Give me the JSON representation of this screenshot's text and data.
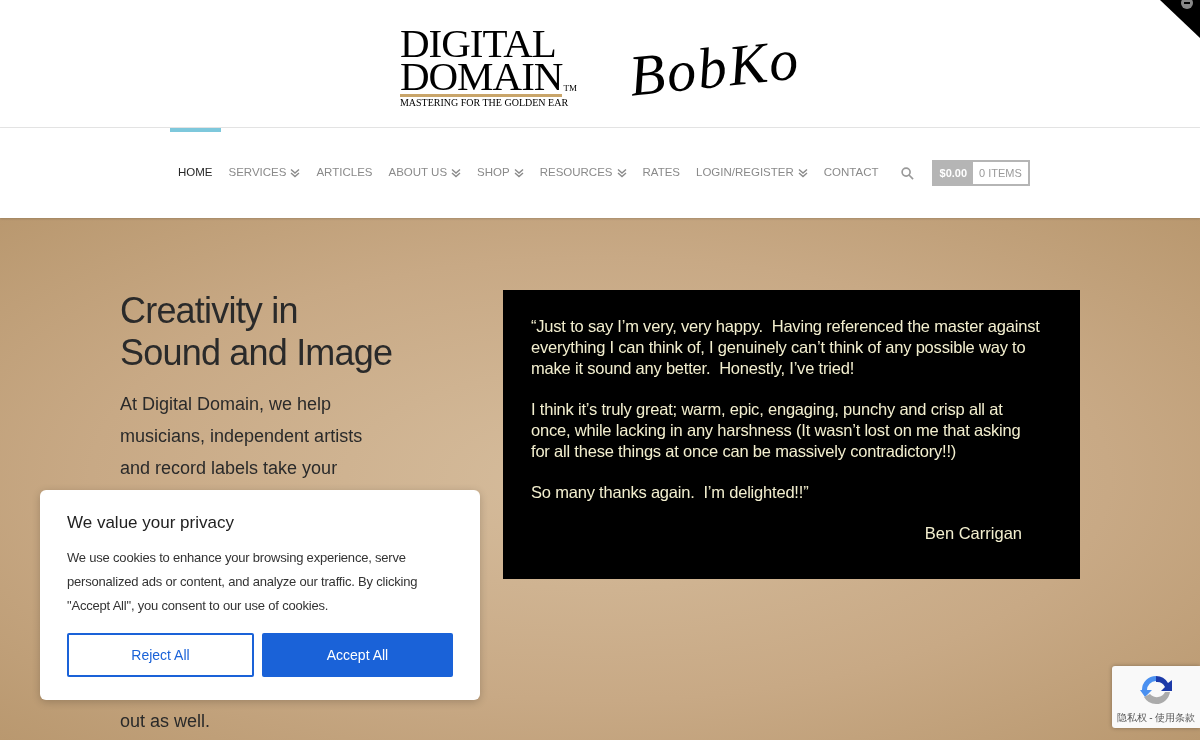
{
  "header": {
    "logo": {
      "title_line_1": "DIGITAL",
      "title_line_2": "DOMAIN",
      "trademark": "TM",
      "tagline": "MASTERING FOR THE GOLDEN EAR"
    },
    "signature": "BobKo"
  },
  "nav": {
    "items": [
      {
        "label": "HOME",
        "selected": true,
        "has_dropdown": false
      },
      {
        "label": "SERVICES",
        "selected": false,
        "has_dropdown": true
      },
      {
        "label": "ARTICLES",
        "selected": false,
        "has_dropdown": false
      },
      {
        "label": "ABOUT US",
        "selected": false,
        "has_dropdown": true
      },
      {
        "label": "SHOP",
        "selected": false,
        "has_dropdown": true
      },
      {
        "label": "RESOURCES",
        "selected": false,
        "has_dropdown": true
      },
      {
        "label": "RATES",
        "selected": false,
        "has_dropdown": false
      },
      {
        "label": "LOGIN/REGISTER",
        "selected": false,
        "has_dropdown": true
      },
      {
        "label": "CONTACT",
        "selected": false,
        "has_dropdown": false
      }
    ],
    "cart": {
      "total": "$0.00",
      "items": "0 ITEMS"
    }
  },
  "hero": {
    "heading_line_1": "Creativity in",
    "heading_line_2": "Sound and Image",
    "intro_lines": [
      "At Digital Domain, we help",
      "musicians, independent artists",
      "and record labels take your"
    ],
    "intro_tail": "out as well."
  },
  "testimonial": {
    "paragraphs": [
      "“Just to say I’m very, very happy.  Having referenced the master against everything I can think of, I genuinely can’t think of any possible way to make it sound any better.  Honestly, I’ve tried!",
      "I think it’s truly great; warm, epic, engaging, punchy and crisp all at once, while lacking in any harshness (It wasn’t lost on me that asking for all these things at once can be massively contradictory!!)",
      "So many thanks again.  I’m delighted!!”"
    ],
    "author": "Ben Carrigan"
  },
  "cookie_banner": {
    "title": "We value your privacy",
    "body": "We use cookies to enhance your browsing experience, serve personalized ads or content, and analyze our traffic. By clicking \"Accept All\", you consent to our use of cookies.",
    "reject": "Reject All",
    "accept": "Accept All"
  },
  "recaptcha": {
    "links": "隐私权 - 使用条款"
  }
}
